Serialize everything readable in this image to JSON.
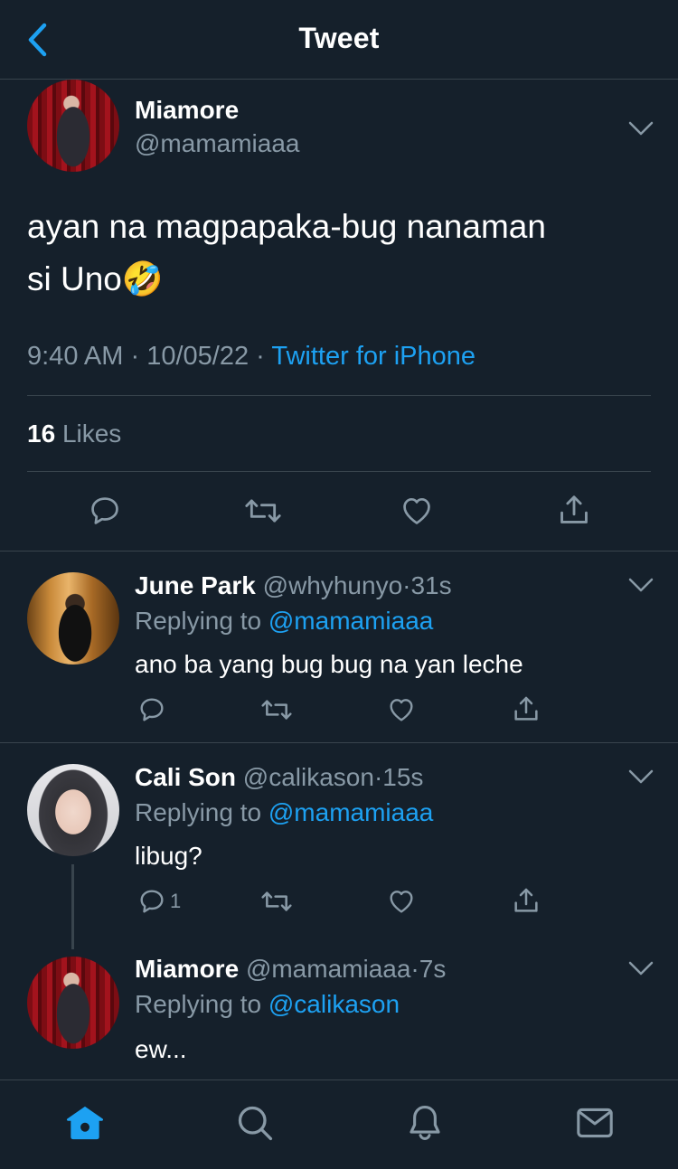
{
  "header": {
    "title": "Tweet"
  },
  "tweet": {
    "author_name": "Miamore",
    "author_handle": "@mamamiaaa",
    "text_line1": "ayan na magpapaka-bug nanaman",
    "text_line2": "si Uno",
    "emoji": "🤣",
    "time": "9:40 AM",
    "date": "10/05/22",
    "source": "Twitter for iPhone",
    "likes_count": "16",
    "likes_label": "Likes"
  },
  "replies": [
    {
      "name": "June Park",
      "handle": "@whyhunyo",
      "age": "31s",
      "replying_label": "Replying to",
      "replying_to": "@mamamiaaa",
      "text": "ano ba yang bug bug na yan leche",
      "reply_count": ""
    },
    {
      "name": "Cali Son",
      "handle": "@calikason",
      "age": "15s",
      "replying_label": "Replying to",
      "replying_to": "@mamamiaaa",
      "text": "libug?",
      "reply_count": "1"
    },
    {
      "name": "Miamore",
      "handle": "@mamamiaaa",
      "age": "7s",
      "replying_label": "Replying to",
      "replying_to": "@calikason",
      "text": "ew..."
    }
  ],
  "separator": "·",
  "tabs": [
    "home-icon",
    "search-icon",
    "notifications-icon",
    "messages-icon"
  ],
  "colors": {
    "background": "#15202b",
    "accent": "#1da1f2",
    "secondary_text": "#8899a6",
    "divider": "#38444d"
  }
}
